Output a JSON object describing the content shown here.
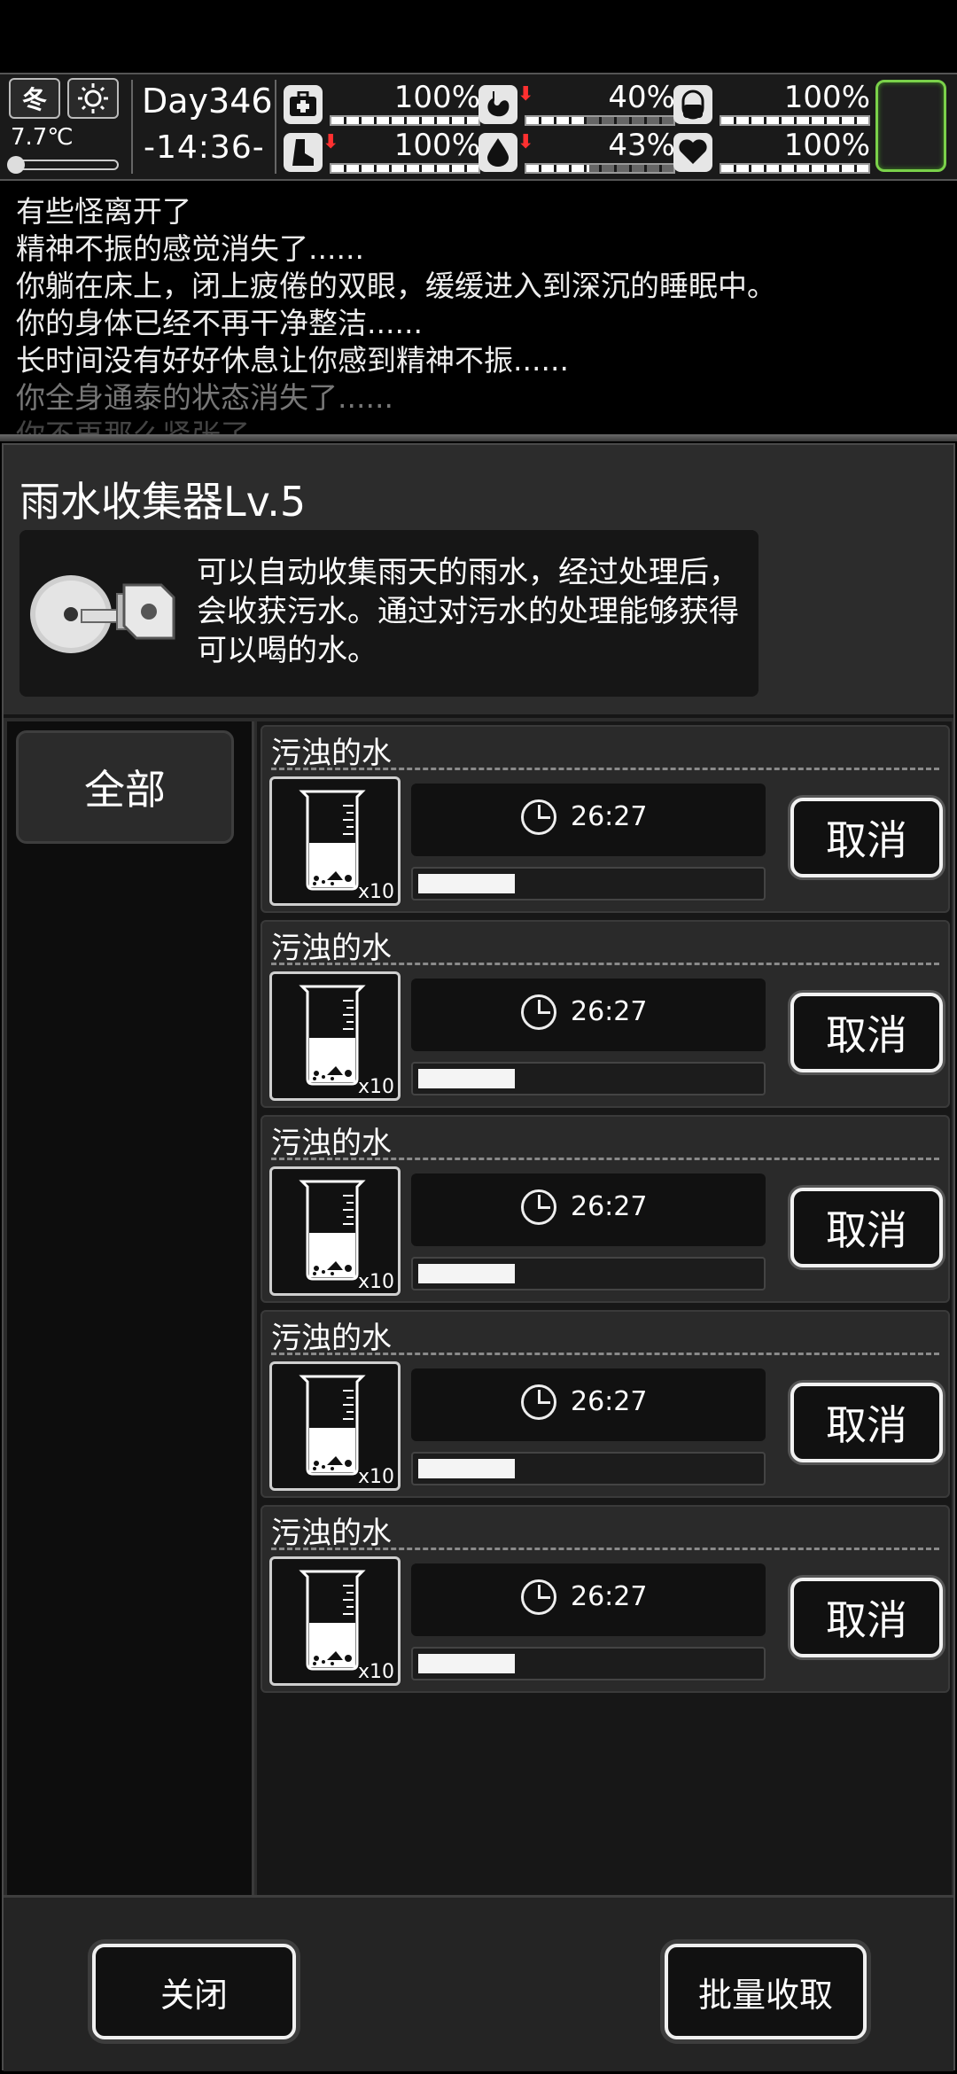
{
  "status": {
    "season": "冬",
    "weather_icon": "sun-icon",
    "temperature": "7.7℃",
    "day": "Day346",
    "time": "-14:36-",
    "stats": [
      {
        "name": "health",
        "icon": "first-aid-icon",
        "value": "100%",
        "level": 1.0,
        "decreasing": false
      },
      {
        "name": "hunger",
        "icon": "stomach-icon",
        "value": "40%",
        "level": 0.4,
        "decreasing": true
      },
      {
        "name": "sanity",
        "icon": "capsule-icon",
        "value": "100%",
        "level": 1.0,
        "decreasing": false
      },
      {
        "name": "stamina",
        "icon": "boot-icon",
        "value": "100%",
        "level": 1.0,
        "decreasing": true
      },
      {
        "name": "thirst",
        "icon": "water-drop-icon",
        "value": "43%",
        "level": 0.43,
        "decreasing": true
      },
      {
        "name": "mood",
        "icon": "heart-icon",
        "value": "100%",
        "level": 1.0,
        "decreasing": false
      }
    ]
  },
  "log": [
    "有些怪离开了",
    "精神不振的感觉消失了......",
    "你躺在床上，闭上疲倦的双眼，缓缓进入到深沉的睡眠中。",
    "你的身体已经不再干净整洁......",
    "长时间没有好好休息让你感到精神不振......",
    "你全身通泰的状态消失了......",
    "你不再那么紧张了"
  ],
  "panel": {
    "title": "雨水收集器Lv.5",
    "description": "可以自动收集雨天的雨水，经过处理后，会收获污水。通过对污水的处理能够获得可以喝的水。",
    "category_tab": "全部",
    "items": [
      {
        "name": "污浊的水",
        "qty": "x10",
        "time": "26:27",
        "progress": 0.28,
        "cancel": "取消"
      },
      {
        "name": "污浊的水",
        "qty": "x10",
        "time": "26:27",
        "progress": 0.28,
        "cancel": "取消"
      },
      {
        "name": "污浊的水",
        "qty": "x10",
        "time": "26:27",
        "progress": 0.28,
        "cancel": "取消"
      },
      {
        "name": "污浊的水",
        "qty": "x10",
        "time": "26:27",
        "progress": 0.28,
        "cancel": "取消"
      },
      {
        "name": "污浊的水",
        "qty": "x10",
        "time": "26:27",
        "progress": 0.28,
        "cancel": "取消"
      }
    ],
    "close_button": "关闭",
    "collect_all_button": "批量收取"
  }
}
